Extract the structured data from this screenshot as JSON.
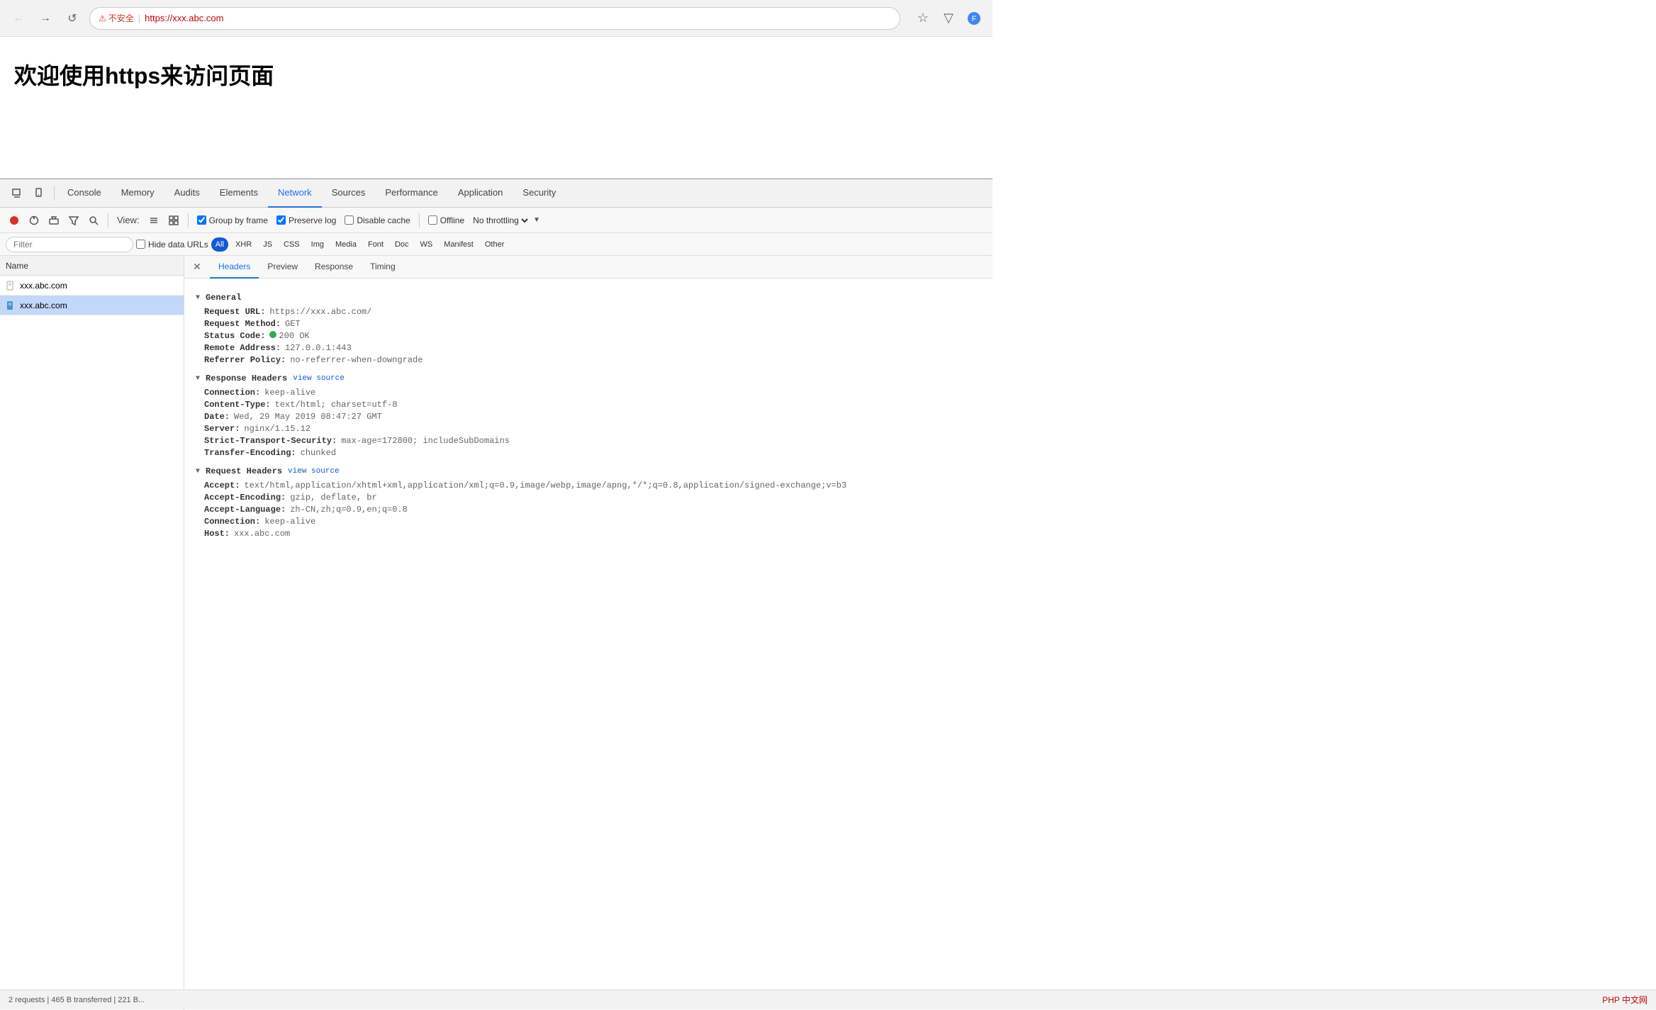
{
  "browser": {
    "url": "https://xxx.abc.com",
    "security_warning": "不安全",
    "security_icon": "⚠",
    "back_btn": "←",
    "forward_btn": "→",
    "reload_btn": "↺",
    "bookmark_icon": "☆",
    "menu_icon": "≡",
    "extension_icon": "▽"
  },
  "page": {
    "title": "欢迎使用https来访问页面"
  },
  "devtools": {
    "tabs": [
      {
        "label": "Console",
        "active": false
      },
      {
        "label": "Memory",
        "active": false
      },
      {
        "label": "Audits",
        "active": false
      },
      {
        "label": "Elements",
        "active": false
      },
      {
        "label": "Network",
        "active": true
      },
      {
        "label": "Sources",
        "active": false
      },
      {
        "label": "Performance",
        "active": false
      },
      {
        "label": "Application",
        "active": false
      },
      {
        "label": "Security",
        "active": false
      }
    ],
    "toolbar": {
      "view_label": "View:",
      "group_by_frame_label": "Group by frame",
      "group_by_frame_checked": true,
      "preserve_log_label": "Preserve log",
      "preserve_log_checked": true,
      "disable_cache_label": "Disable cache",
      "disable_cache_checked": false,
      "offline_label": "Offline",
      "offline_checked": false,
      "throttle_label": "No throttling"
    },
    "filter_bar": {
      "filter_placeholder": "Filter",
      "hide_data_urls_label": "Hide data URLs",
      "hide_data_urls_checked": false,
      "types": [
        "All",
        "XHR",
        "JS",
        "CSS",
        "Img",
        "Media",
        "Font",
        "Doc",
        "WS",
        "Manifest",
        "Other"
      ],
      "active_type": "All"
    }
  },
  "request_list": {
    "header": "Name",
    "items": [
      {
        "name": "xxx.abc.com",
        "selected": false
      },
      {
        "name": "xxx.abc.com",
        "selected": true
      }
    ]
  },
  "detail": {
    "tabs": [
      "Headers",
      "Preview",
      "Response",
      "Timing"
    ],
    "active_tab": "Headers",
    "sections": {
      "general": {
        "title": "General",
        "fields": [
          {
            "name": "Request URL:",
            "value": "https://xxx.abc.com/"
          },
          {
            "name": "Request Method:",
            "value": "GET"
          },
          {
            "name": "Status Code:",
            "value": "200 OK",
            "has_dot": true
          },
          {
            "name": "Remote Address:",
            "value": "127.0.0.1:443"
          },
          {
            "name": "Referrer Policy:",
            "value": "no-referrer-when-downgrade"
          }
        ]
      },
      "response_headers": {
        "title": "Response Headers",
        "view_source": "view source",
        "fields": [
          {
            "name": "Connection:",
            "value": "keep-alive"
          },
          {
            "name": "Content-Type:",
            "value": "text/html; charset=utf-8"
          },
          {
            "name": "Date:",
            "value": "Wed, 29 May 2019 08:47:27 GMT"
          },
          {
            "name": "Server:",
            "value": "nginx/1.15.12"
          },
          {
            "name": "Strict-Transport-Security:",
            "value": "max-age=172800; includeSubDomains"
          },
          {
            "name": "Transfer-Encoding:",
            "value": "chunked"
          }
        ]
      },
      "request_headers": {
        "title": "Request Headers",
        "view_source": "view source",
        "fields": [
          {
            "name": "Accept:",
            "value": "text/html,application/xhtml+xml,application/xml;q=0.9,image/webp,image/apng,*/*;q=0.8,application/signed-exchange;v=b3"
          },
          {
            "name": "Accept-Encoding:",
            "value": "gzip, deflate, br"
          },
          {
            "name": "Accept-Language:",
            "value": "zh-CN,zh;q=0.9,en;q=0.8"
          },
          {
            "name": "Connection:",
            "value": "keep-alive"
          },
          {
            "name": "Host:",
            "value": "xxx.abc.com"
          }
        ]
      }
    }
  },
  "status_bar": {
    "text": "2 requests | 465 B transferred | 221 B...",
    "watermark": "PHP 中文网"
  }
}
